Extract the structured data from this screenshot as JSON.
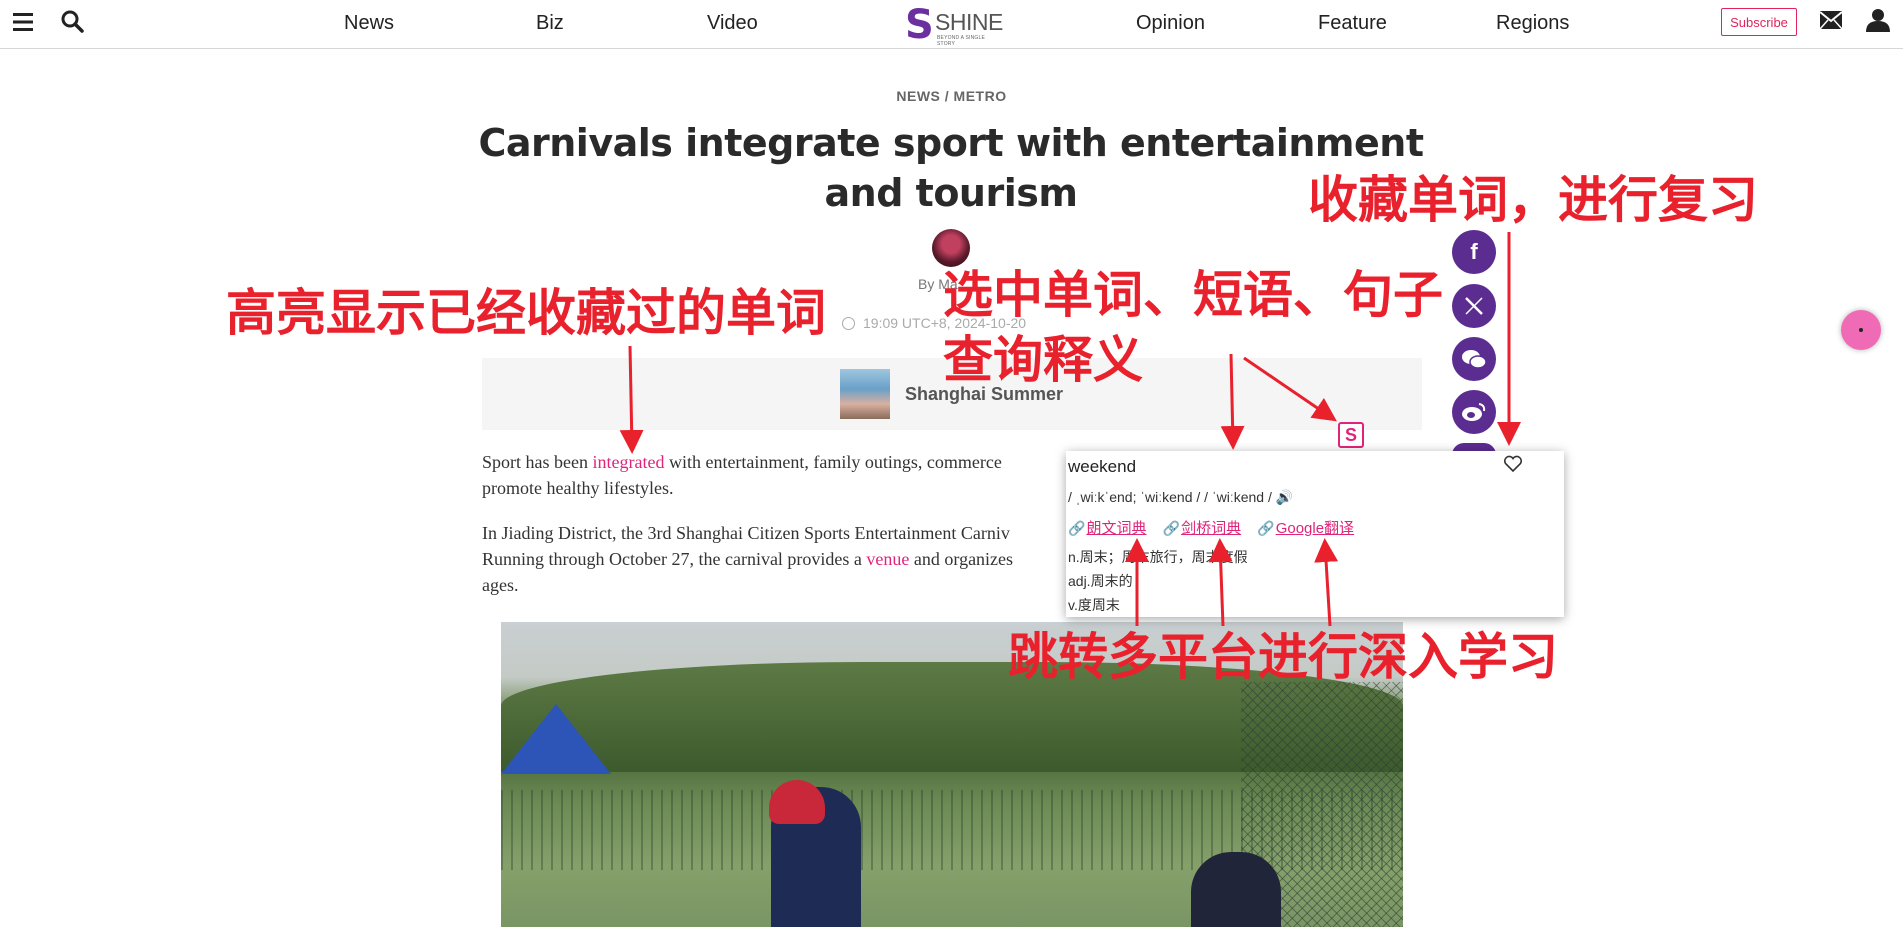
{
  "nav": {
    "left_links": [
      "News",
      "Biz",
      "Video"
    ],
    "right_links": [
      "Opinion",
      "Feature",
      "Regions"
    ],
    "logo_word": "SHINE",
    "logo_tagline": "BEYOND A SINGLE STORY",
    "subscribe_label": "Subscribe",
    "icons": [
      "menu-icon",
      "search-icon",
      "mail-icon",
      "user-icon"
    ]
  },
  "article": {
    "section": "NEWS / METRO",
    "title": "Carnivals integrate sport with entertainment and tourism",
    "byline": "By Ma",
    "timestamp": "19:09 UTC+8, 2024-10-20",
    "series": "Shanghai Summer",
    "para1_before": "Sport has been ",
    "para1_highlight": "integrated",
    "para1_after": " with entertainment, family outings, commerce",
    "para1_line2": "promote healthy lifestyles.",
    "para2_line1": "In Jiading District, the 3rd Shanghai Citizen Sports Entertainment Carniv",
    "para2_line2_before": "Running through October 27, the carnival provides a ",
    "para2_highlight": "venue",
    "para2_line2_after": " and organizes",
    "para2_line3": "ages."
  },
  "social": [
    "facebook-icon",
    "x-icon",
    "wechat-icon",
    "weibo-icon"
  ],
  "popup": {
    "trigger": "S",
    "word": "weekend",
    "phonetic": "/ ˌwiːkˈend; ˈwiːkend / / ˈwiːkend /",
    "links": [
      "朗文词典",
      "剑桥词典",
      "Google翻译"
    ],
    "definitions": [
      "n.周末；周末旅行，周末度假",
      "adj.周末的",
      "v.度周末"
    ]
  },
  "annotations": {
    "favorite": "收藏单词，进行复习",
    "highlight": "高亮显示已经收藏过的单词",
    "select_line1": "选中单词、短语、句子",
    "select_line2": "查询释义",
    "jump": "跳转多平台进行深入学习"
  },
  "colors": {
    "accent": "#e0247a",
    "brand_purple": "#5b2d91",
    "annotation_red": "#e8212d"
  }
}
